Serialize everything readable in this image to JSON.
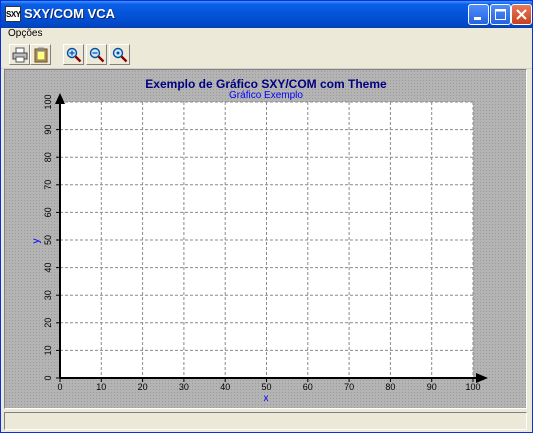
{
  "window": {
    "title": "SXY/COM VCA",
    "icon_label": "SXY",
    "controls": {
      "minimize": "minimize-icon",
      "maximize": "maximize-icon",
      "close": "close-icon"
    }
  },
  "menu": {
    "items": [
      {
        "label": "Opções"
      }
    ]
  },
  "toolbar": {
    "buttons": [
      {
        "icon": "print-icon"
      },
      {
        "icon": "clipboard-icon"
      },
      {
        "icon": "zoom-in-icon"
      },
      {
        "icon": "zoom-out-icon"
      },
      {
        "icon": "zoom-reset-icon"
      }
    ]
  },
  "colors": {
    "title_color": "#000080",
    "subtitle_color": "#0000ff",
    "axis_label_color": "#0000ff",
    "plot_bg": "#ffffff",
    "chart_bg": "#b4b4b4"
  },
  "chart_data": {
    "type": "scatter",
    "title": "Exemplo de Gráfico SXY/COM com Theme",
    "subtitle": "Gráfico Exemplo",
    "xlabel": "x",
    "ylabel": "y",
    "xlim": [
      0,
      100
    ],
    "ylim": [
      0,
      100
    ],
    "x_ticks": [
      0,
      10,
      20,
      30,
      40,
      50,
      60,
      70,
      80,
      90,
      100
    ],
    "y_ticks": [
      0,
      10,
      20,
      30,
      40,
      50,
      60,
      70,
      80,
      90,
      100
    ],
    "grid": true,
    "series": []
  }
}
